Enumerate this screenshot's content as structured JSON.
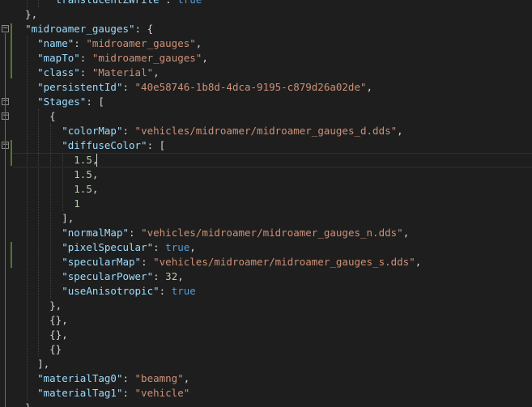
{
  "editor": {
    "lines": [
      {
        "tokens": [
          {
            "t": "      "
          },
          {
            "t": "\"translucentZWrite\"",
            "c": "key"
          },
          {
            "t": ": "
          },
          {
            "t": "true",
            "c": "kw"
          }
        ]
      },
      {
        "tokens": [
          {
            "t": "  },"
          }
        ]
      },
      {
        "tokens": [
          {
            "t": "  "
          },
          {
            "t": "\"midroamer_gauges\"",
            "c": "key"
          },
          {
            "t": ": {"
          }
        ]
      },
      {
        "tokens": [
          {
            "t": "    "
          },
          {
            "t": "\"name\"",
            "c": "key"
          },
          {
            "t": ": "
          },
          {
            "t": "\"midroamer_gauges\"",
            "c": "str"
          },
          {
            "t": ","
          }
        ]
      },
      {
        "tokens": [
          {
            "t": "    "
          },
          {
            "t": "\"mapTo\"",
            "c": "key"
          },
          {
            "t": ": "
          },
          {
            "t": "\"midroamer_gauges\"",
            "c": "str"
          },
          {
            "t": ","
          }
        ]
      },
      {
        "tokens": [
          {
            "t": "    "
          },
          {
            "t": "\"class\"",
            "c": "key"
          },
          {
            "t": ": "
          },
          {
            "t": "\"Material\"",
            "c": "str"
          },
          {
            "t": ","
          }
        ]
      },
      {
        "tokens": [
          {
            "t": "    "
          },
          {
            "t": "\"persistentId\"",
            "c": "key"
          },
          {
            "t": ": "
          },
          {
            "t": "\"40e58746-1b8d-4dca-9195-c879d26a02de\"",
            "c": "str"
          },
          {
            "t": ","
          }
        ]
      },
      {
        "tokens": [
          {
            "t": "    "
          },
          {
            "t": "\"Stages\"",
            "c": "key"
          },
          {
            "t": ": ["
          }
        ]
      },
      {
        "tokens": [
          {
            "t": "      {"
          }
        ]
      },
      {
        "tokens": [
          {
            "t": "        "
          },
          {
            "t": "\"colorMap\"",
            "c": "key"
          },
          {
            "t": ": "
          },
          {
            "t": "\"vehicles/midroamer/midroamer_gauges_d.dds\"",
            "c": "str"
          },
          {
            "t": ","
          }
        ]
      },
      {
        "tokens": [
          {
            "t": "        "
          },
          {
            "t": "\"diffuseColor\"",
            "c": "key"
          },
          {
            "t": ": ["
          }
        ]
      },
      {
        "tokens": [
          {
            "t": "          "
          },
          {
            "t": "1.5",
            "c": "num"
          },
          {
            "t": ","
          }
        ]
      },
      {
        "tokens": [
          {
            "t": "          "
          },
          {
            "t": "1.5",
            "c": "num"
          },
          {
            "t": ","
          }
        ]
      },
      {
        "tokens": [
          {
            "t": "          "
          },
          {
            "t": "1.5",
            "c": "num"
          },
          {
            "t": ","
          }
        ]
      },
      {
        "tokens": [
          {
            "t": "          "
          },
          {
            "t": "1",
            "c": "num"
          }
        ]
      },
      {
        "tokens": [
          {
            "t": "        ],"
          }
        ]
      },
      {
        "tokens": [
          {
            "t": "        "
          },
          {
            "t": "\"normalMap\"",
            "c": "key"
          },
          {
            "t": ": "
          },
          {
            "t": "\"vehicles/midroamer/midroamer_gauges_n.dds\"",
            "c": "str"
          },
          {
            "t": ","
          }
        ]
      },
      {
        "tokens": [
          {
            "t": "        "
          },
          {
            "t": "\"pixelSpecular\"",
            "c": "key"
          },
          {
            "t": ": "
          },
          {
            "t": "true",
            "c": "kw"
          },
          {
            "t": ","
          }
        ]
      },
      {
        "tokens": [
          {
            "t": "        "
          },
          {
            "t": "\"specularMap\"",
            "c": "key"
          },
          {
            "t": ": "
          },
          {
            "t": "\"vehicles/midroamer/midroamer_gauges_s.dds\"",
            "c": "str"
          },
          {
            "t": ","
          }
        ]
      },
      {
        "tokens": [
          {
            "t": "        "
          },
          {
            "t": "\"specularPower\"",
            "c": "key"
          },
          {
            "t": ": "
          },
          {
            "t": "32",
            "c": "num"
          },
          {
            "t": ","
          }
        ]
      },
      {
        "tokens": [
          {
            "t": "        "
          },
          {
            "t": "\"useAnisotropic\"",
            "c": "key"
          },
          {
            "t": ": "
          },
          {
            "t": "true",
            "c": "kw"
          }
        ]
      },
      {
        "tokens": [
          {
            "t": "      },"
          }
        ]
      },
      {
        "tokens": [
          {
            "t": "      {},"
          }
        ]
      },
      {
        "tokens": [
          {
            "t": "      {},"
          }
        ]
      },
      {
        "tokens": [
          {
            "t": "      {}"
          }
        ]
      },
      {
        "tokens": [
          {
            "t": "    ],"
          }
        ]
      },
      {
        "tokens": [
          {
            "t": "    "
          },
          {
            "t": "\"materialTag0\"",
            "c": "key"
          },
          {
            "t": ": "
          },
          {
            "t": "\"beamng\"",
            "c": "str"
          },
          {
            "t": ","
          }
        ]
      },
      {
        "tokens": [
          {
            "t": "    "
          },
          {
            "t": "\"materialTag1\"",
            "c": "key"
          },
          {
            "t": ": "
          },
          {
            "t": "\"vehicle\"",
            "c": "str"
          }
        ]
      },
      {
        "tokens": [
          {
            "t": "  },"
          }
        ]
      }
    ],
    "fold_markers": [
      {
        "line": 2,
        "symbol": "−"
      },
      {
        "line": 7,
        "symbol": "−"
      },
      {
        "line": 8,
        "symbol": "−"
      },
      {
        "line": 10,
        "symbol": "−"
      }
    ],
    "current_line": 11,
    "caret_col": 14,
    "colors": {
      "background": "#1e1e1e",
      "key": "#9cdcfe",
      "string": "#ce9178",
      "number": "#b5cea8",
      "keyword": "#569cd6",
      "punctuation": "#d4d4d4"
    }
  }
}
